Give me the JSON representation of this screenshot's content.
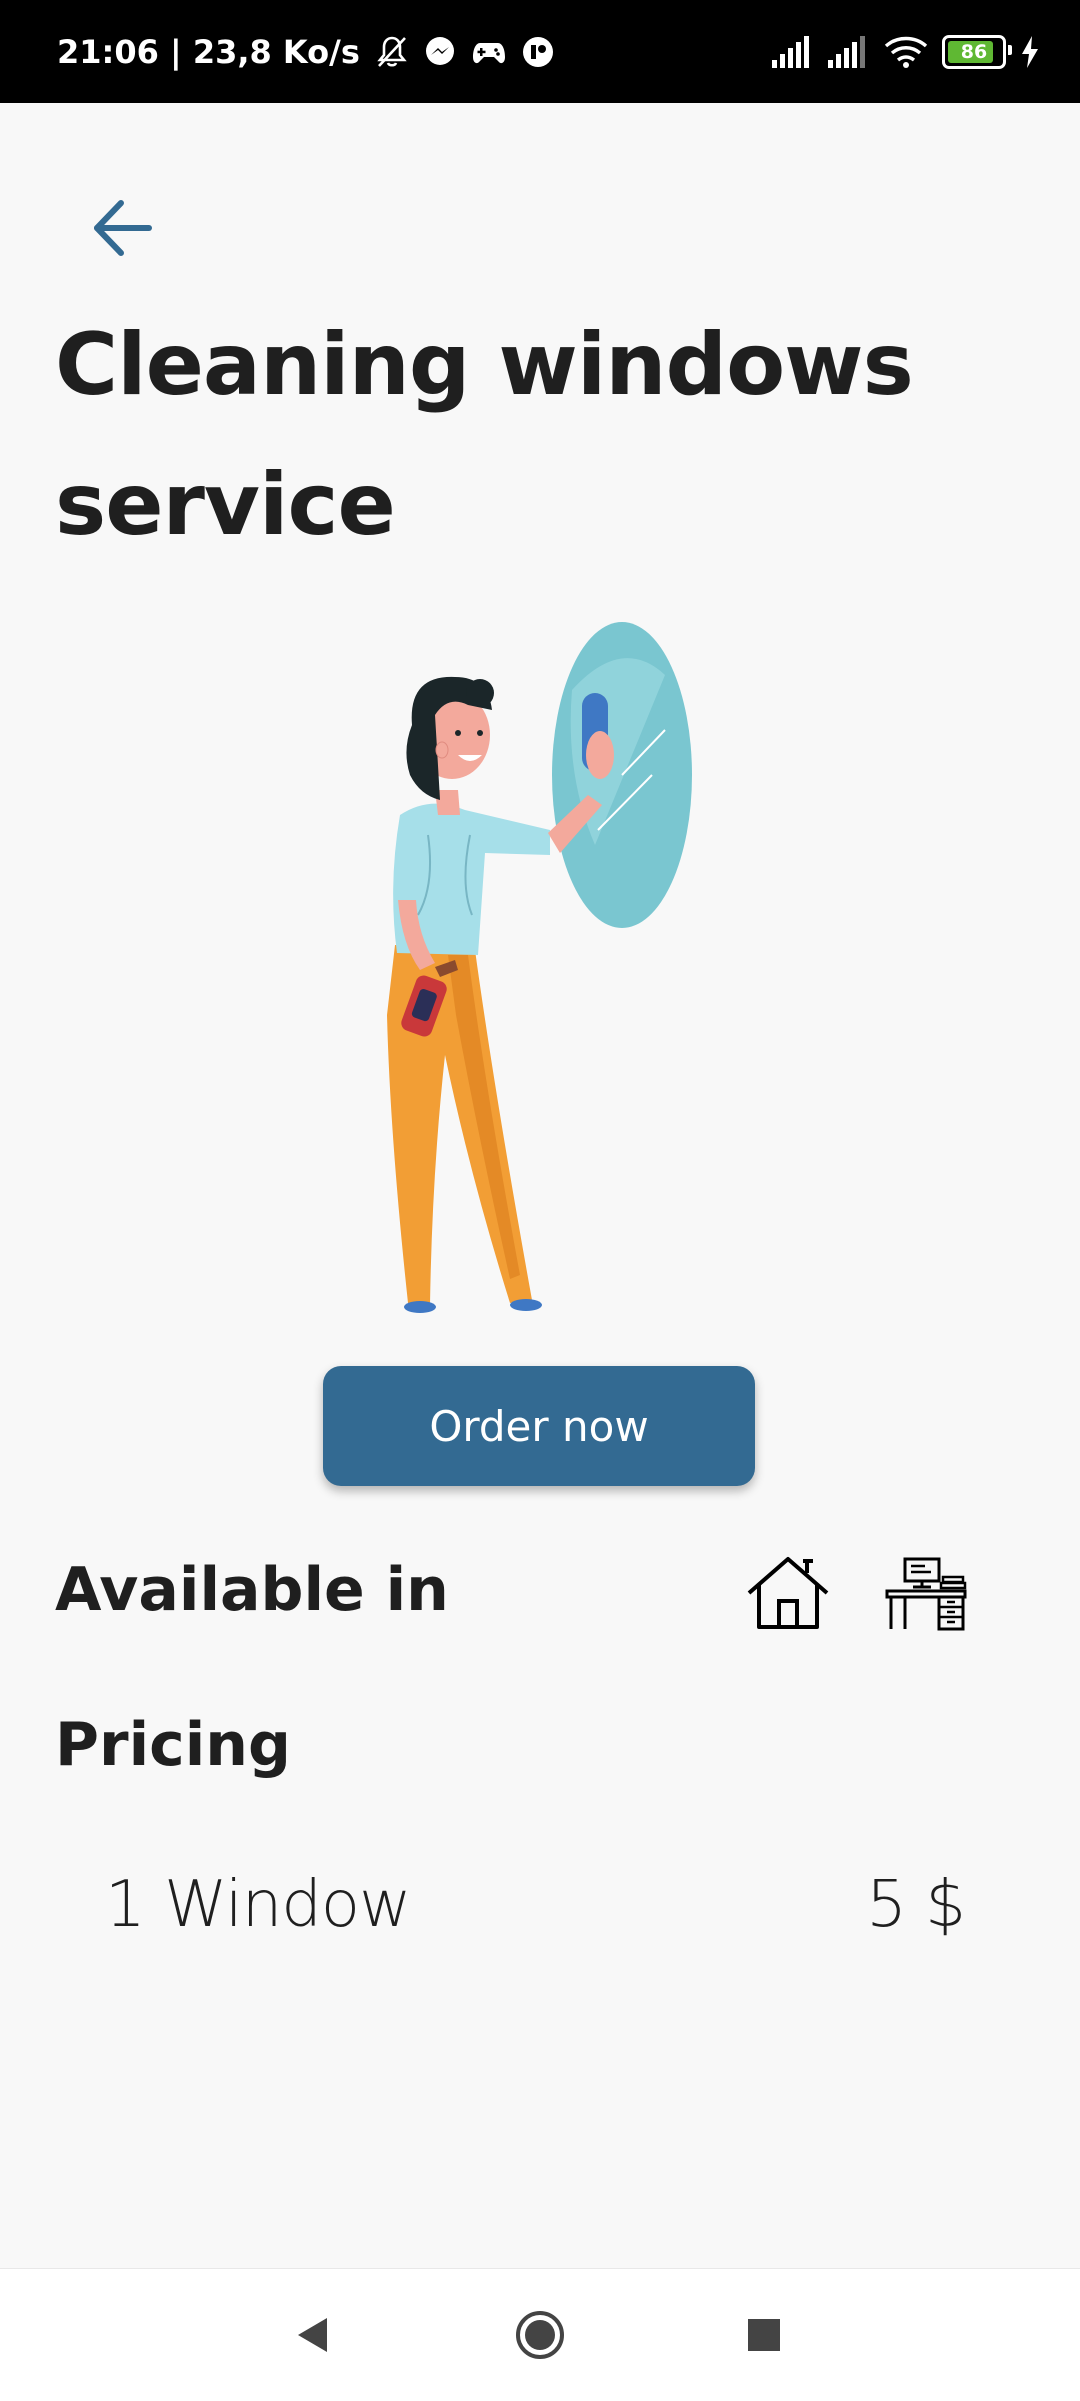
{
  "status_bar": {
    "time_and_speed": "21:06 | 23,8 Ko/s",
    "battery_level": "86",
    "icons": [
      "bell-off-icon",
      "messenger-icon",
      "gamepad-icon",
      "app-icon",
      "signal-icon",
      "signal-icon",
      "wifi-icon",
      "battery-icon",
      "charging-icon"
    ]
  },
  "header": {
    "back_icon": "arrow-back-icon",
    "title": "Cleaning windows service"
  },
  "illustration": {
    "icon": "woman-cleaning-mirror-illustration"
  },
  "order_button": {
    "label": "Order now"
  },
  "available": {
    "heading": "Available in",
    "icons": [
      "house-icon",
      "office-desk-icon"
    ]
  },
  "pricing": {
    "heading": "Pricing",
    "items": [
      {
        "label": "1 Window",
        "price": "5 $"
      }
    ]
  },
  "navigation_bar": {
    "icons": [
      "back-triangle-icon",
      "home-circle-icon",
      "recents-square-icon"
    ]
  },
  "colors": {
    "background": "#f8f8f8",
    "accent": "#336a92",
    "text": "#1f1f1f"
  }
}
